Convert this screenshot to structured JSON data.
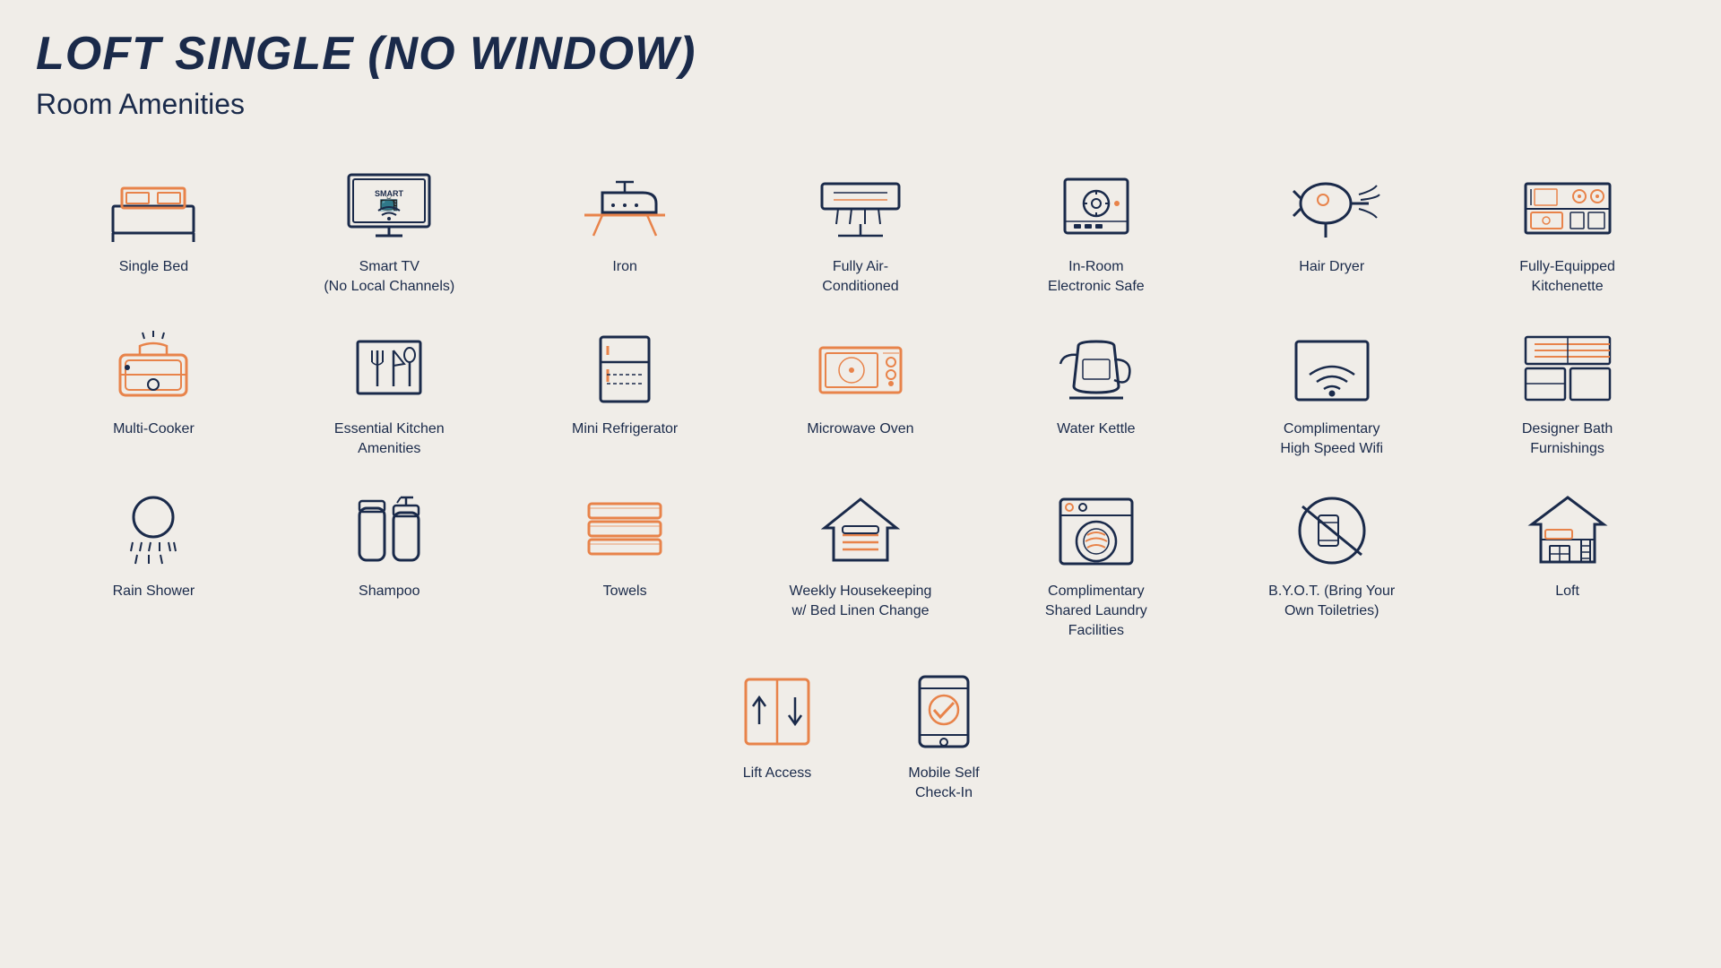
{
  "title": "LOFT SINGLE (NO WINDOW)",
  "subtitle": "Room Amenities",
  "amenities": [
    {
      "id": "single-bed",
      "label": "Single Bed",
      "icon": "bed"
    },
    {
      "id": "smart-tv",
      "label": "Smart TV\n(No Local Channels)",
      "icon": "tv"
    },
    {
      "id": "iron",
      "label": "Iron",
      "icon": "iron"
    },
    {
      "id": "air-conditioned",
      "label": "Fully Air-\nConditioned",
      "icon": "ac"
    },
    {
      "id": "electronic-safe",
      "label": "In-Room\nElectronic Safe",
      "icon": "safe"
    },
    {
      "id": "hair-dryer",
      "label": "Hair Dryer",
      "icon": "hairdryer"
    },
    {
      "id": "kitchenette",
      "label": "Fully-Equipped\nKitchenette",
      "icon": "kitchenette"
    },
    {
      "id": "multi-cooker",
      "label": "Multi-Cooker",
      "icon": "multicooker"
    },
    {
      "id": "kitchen-amenities",
      "label": "Essential Kitchen\nAmenities",
      "icon": "kitchen"
    },
    {
      "id": "mini-fridge",
      "label": "Mini Refrigerator",
      "icon": "fridge"
    },
    {
      "id": "microwave",
      "label": "Microwave Oven",
      "icon": "microwave"
    },
    {
      "id": "kettle",
      "label": "Water Kettle",
      "icon": "kettle"
    },
    {
      "id": "wifi",
      "label": "Complimentary\nHigh Speed Wifi",
      "icon": "wifi"
    },
    {
      "id": "bath",
      "label": "Designer Bath\nFurnishings",
      "icon": "bath"
    },
    {
      "id": "rain-shower",
      "label": "Rain Shower",
      "icon": "shower"
    },
    {
      "id": "shampoo",
      "label": "Shampoo",
      "icon": "shampoo"
    },
    {
      "id": "towels",
      "label": "Towels",
      "icon": "towels"
    },
    {
      "id": "housekeeping",
      "label": "Weekly Housekeeping\nw/ Bed Linen Change",
      "icon": "housekeeping"
    },
    {
      "id": "laundry",
      "label": "Complimentary\nShared Laundry\nFacilities",
      "icon": "laundry"
    },
    {
      "id": "byot",
      "label": "B.Y.O.T. (Bring Your\nOwn Toiletries)",
      "icon": "byot"
    },
    {
      "id": "loft",
      "label": "Loft",
      "icon": "loft"
    },
    {
      "id": "lift",
      "label": "Lift Access",
      "icon": "lift"
    },
    {
      "id": "checkin",
      "label": "Mobile Self\nCheck-In",
      "icon": "checkin"
    }
  ],
  "colors": {
    "navy": "#1a2a4a",
    "orange": "#e8834a",
    "bg": "#f0ede8"
  }
}
